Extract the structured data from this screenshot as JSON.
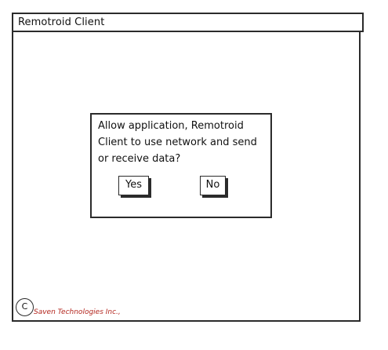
{
  "window": {
    "title": "Remotroid Client"
  },
  "dialog": {
    "message": "Allow application, Remotroid Client to use network and send or receive data?",
    "yes_label": "Yes",
    "no_label": "No"
  },
  "footer": {
    "copyright_symbol": "C",
    "company": "Saven Technologies Inc.,"
  },
  "colors": {
    "border": "#2b2b2b",
    "company_text": "#b3261e",
    "background": "#ffffff"
  },
  "icons": {
    "copyright": "copyright-icon"
  }
}
